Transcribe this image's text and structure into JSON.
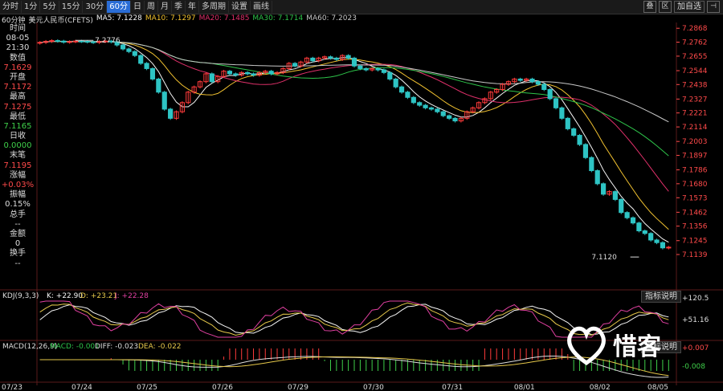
{
  "toolbar": {
    "periods": [
      "分时",
      "1分",
      "5分",
      "15分",
      "30分",
      "60分",
      "日",
      "周",
      "月",
      "季",
      "年",
      "多周期",
      "设置",
      "画线"
    ],
    "active": "60分",
    "right_icons": [
      "叠",
      "区",
      "加自选"
    ]
  },
  "info": {
    "period": "60分钟",
    "name": "美元人民币(CFETS)",
    "ma5": "MA5: 7.1228",
    "ma10": "MA10: 7.1297",
    "ma20": "MA20: 7.1485",
    "ma30": "MA30: 7.1714",
    "ma60": "MA60: 7.2023"
  },
  "sidebar": [
    {
      "label": "时间",
      "color": "white"
    },
    {
      "label": "08-05",
      "color": "white"
    },
    {
      "label": "21:30",
      "color": "white"
    },
    {
      "label": "数值",
      "color": "white"
    },
    {
      "label": "7.1629",
      "color": "red"
    },
    {
      "label": "开盘",
      "color": "white"
    },
    {
      "label": "7.1172",
      "color": "red"
    },
    {
      "label": "最高",
      "color": "white"
    },
    {
      "label": "7.1275",
      "color": "red"
    },
    {
      "label": "最低",
      "color": "white"
    },
    {
      "label": "7.1165",
      "color": "green"
    },
    {
      "label": "日收",
      "color": "white"
    },
    {
      "label": "0.0000",
      "color": "green"
    },
    {
      "label": "末笔",
      "color": "white"
    },
    {
      "label": "7.1195",
      "color": "red"
    },
    {
      "label": "涨幅",
      "color": "white"
    },
    {
      "label": "+0.03%",
      "color": "red"
    },
    {
      "label": "振幅",
      "color": "white"
    },
    {
      "label": "0.15%",
      "color": "white"
    },
    {
      "label": "总手",
      "color": "white"
    },
    {
      "label": "--",
      "color": "white"
    },
    {
      "label": "金额",
      "color": "white"
    },
    {
      "label": "0",
      "color": "white"
    },
    {
      "label": "换手",
      "color": "white"
    },
    {
      "label": "--",
      "color": "white"
    }
  ],
  "chart_data": [
    {
      "type": "candlestick",
      "title": "美元人民币(CFETS) 60分钟",
      "price_ticks": [
        "7.2868",
        "7.2762",
        "7.2655",
        "7.2544",
        "7.2438",
        "7.2327",
        "7.2221",
        "7.2114",
        "7.2003",
        "7.1897",
        "7.1786",
        "7.1680",
        "7.1573",
        "7.1462",
        "7.1356",
        "7.1245",
        "7.1139"
      ],
      "ylim": [
        7.109,
        7.29
      ],
      "dates": [
        "07/23",
        "07/24",
        "07/25",
        "07/26",
        "07/29",
        "07/30",
        "07/31",
        "08/01",
        "08/02",
        "08/05"
      ],
      "annotations": {
        "high_label": "7.2776",
        "low_label": "7.1120"
      },
      "closes": [
        7.276,
        7.2768,
        7.2774,
        7.277,
        7.2762,
        7.2766,
        7.277,
        7.2768,
        7.2764,
        7.276,
        7.2766,
        7.277,
        7.2764,
        7.274,
        7.271,
        7.269,
        7.266,
        7.26,
        7.256,
        7.248,
        7.238,
        7.225,
        7.218,
        7.223,
        7.23,
        7.238,
        7.242,
        7.246,
        7.252,
        7.246,
        7.25,
        7.254,
        7.252,
        7.251,
        7.253,
        7.252,
        7.251,
        7.253,
        7.254,
        7.252,
        7.253,
        7.256,
        7.26,
        7.258,
        7.261,
        7.264,
        7.262,
        7.264,
        7.265,
        7.264,
        7.263,
        7.266,
        7.264,
        7.258,
        7.256,
        7.255,
        7.256,
        7.255,
        7.253,
        7.248,
        7.242,
        7.238,
        7.234,
        7.23,
        7.228,
        7.226,
        7.225,
        7.223,
        7.22,
        7.218,
        7.216,
        7.218,
        7.223,
        7.226,
        7.23,
        7.233,
        7.238,
        7.24,
        7.244,
        7.246,
        7.248,
        7.247,
        7.248,
        7.246,
        7.244,
        7.24,
        7.233,
        7.226,
        7.218,
        7.21,
        7.205,
        7.198,
        7.188,
        7.178,
        7.168,
        7.16,
        7.162,
        7.156,
        7.146,
        7.142,
        7.138,
        7.132,
        7.13,
        7.125,
        7.123,
        7.119,
        7.1195
      ],
      "ma_lines": [
        {
          "name": "MA5",
          "color": "#f5f5f5"
        },
        {
          "name": "MA10",
          "color": "#f2c230"
        },
        {
          "name": "MA20",
          "color": "#e0306a"
        },
        {
          "name": "MA30",
          "color": "#2ec44a"
        },
        {
          "name": "MA60",
          "color": "#c8c8c8"
        }
      ]
    },
    {
      "type": "line",
      "title": "KDJ(9,3,3)",
      "values": {
        "K": "K: +22.90",
        "D": "D: +23.21",
        "J": "J: +22.28"
      },
      "ticks": [
        "+120.5",
        "+51.16"
      ],
      "series": [
        {
          "name": "K",
          "color": "#f5f5f5"
        },
        {
          "name": "D",
          "color": "#e6c84a"
        },
        {
          "name": "J",
          "color": "#e040a0"
        }
      ]
    },
    {
      "type": "bar",
      "title": "MACD(12,26,9)",
      "values": {
        "MACD": "MACD: -0.001",
        "DIFF": "DIFF: -0.023",
        "DEA": "DEA: -0.022"
      },
      "ticks": [
        "+0.007",
        "-0.008"
      ]
    }
  ],
  "kdj_button": "指标说明",
  "macd_button": "指标说明",
  "watermark": "惜客",
  "colors": {
    "up": "#ff3b3b",
    "down": "#2ec4c4",
    "axis_text": "#ff4a4a",
    "grid": "#3a2020"
  }
}
